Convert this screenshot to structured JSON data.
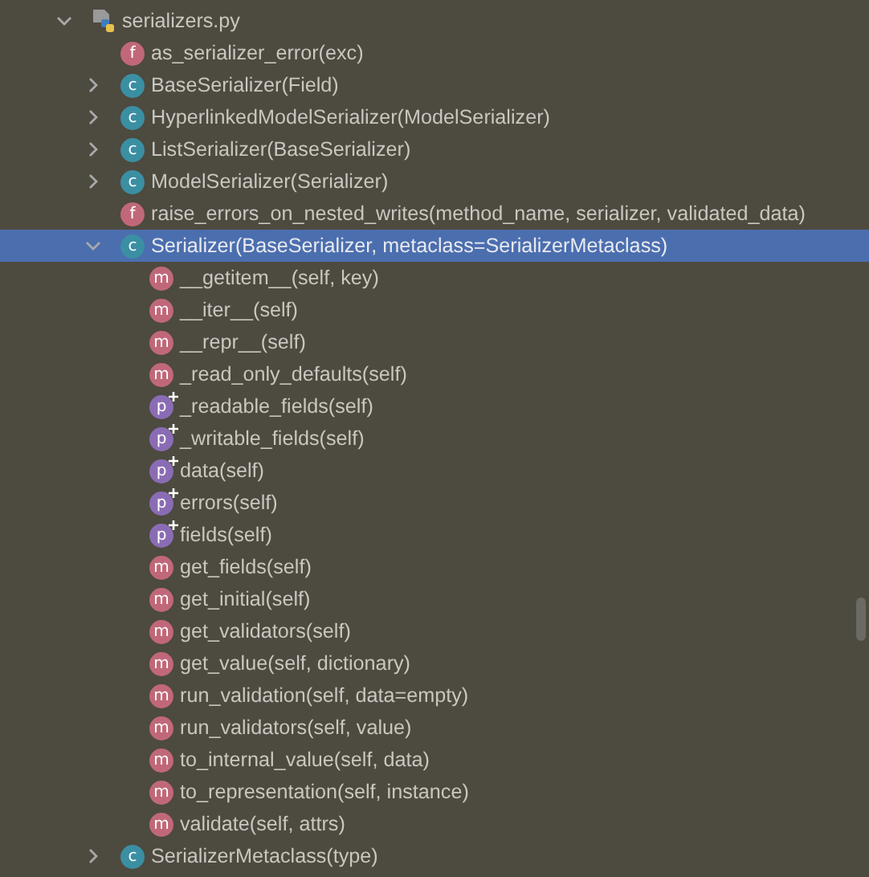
{
  "tree": [
    {
      "label": "serializers.py",
      "kind": "file",
      "expanded": true,
      "selected": false,
      "children": [
        {
          "label": "as_serializer_error(exc)",
          "kind": "function",
          "badge": "f",
          "selected": false
        },
        {
          "label": "BaseSerializer(Field)",
          "kind": "class",
          "badge": "c",
          "expanded": false,
          "selected": false
        },
        {
          "label": "HyperlinkedModelSerializer(ModelSerializer)",
          "kind": "class",
          "badge": "c",
          "expanded": false,
          "selected": false
        },
        {
          "label": "ListSerializer(BaseSerializer)",
          "kind": "class",
          "badge": "c",
          "expanded": false,
          "selected": false
        },
        {
          "label": "ModelSerializer(Serializer)",
          "kind": "class",
          "badge": "c",
          "expanded": false,
          "selected": false
        },
        {
          "label": "raise_errors_on_nested_writes(method_name, serializer, validated_data)",
          "kind": "function",
          "badge": "f",
          "selected": false
        },
        {
          "label": "Serializer(BaseSerializer, metaclass=SerializerMetaclass)",
          "kind": "class",
          "badge": "c",
          "expanded": true,
          "selected": true,
          "children": [
            {
              "label": "__getitem__(self, key)",
              "kind": "method",
              "badge": "m",
              "selected": false
            },
            {
              "label": "__iter__(self)",
              "kind": "method",
              "badge": "m",
              "selected": false
            },
            {
              "label": "__repr__(self)",
              "kind": "method",
              "badge": "m",
              "selected": false
            },
            {
              "label": "_read_only_defaults(self)",
              "kind": "method",
              "badge": "m",
              "selected": false
            },
            {
              "label": "_readable_fields(self)",
              "kind": "property",
              "badge": "p",
              "selected": false
            },
            {
              "label": "_writable_fields(self)",
              "kind": "property",
              "badge": "p",
              "selected": false
            },
            {
              "label": "data(self)",
              "kind": "property",
              "badge": "p",
              "selected": false
            },
            {
              "label": "errors(self)",
              "kind": "property",
              "badge": "p",
              "selected": false
            },
            {
              "label": "fields(self)",
              "kind": "property",
              "badge": "p",
              "selected": false
            },
            {
              "label": "get_fields(self)",
              "kind": "method",
              "badge": "m",
              "selected": false
            },
            {
              "label": "get_initial(self)",
              "kind": "method",
              "badge": "m",
              "selected": false
            },
            {
              "label": "get_validators(self)",
              "kind": "method",
              "badge": "m",
              "selected": false
            },
            {
              "label": "get_value(self, dictionary)",
              "kind": "method",
              "badge": "m",
              "selected": false
            },
            {
              "label": "run_validation(self, data=empty)",
              "kind": "method",
              "badge": "m",
              "selected": false
            },
            {
              "label": "run_validators(self, value)",
              "kind": "method",
              "badge": "m",
              "selected": false
            },
            {
              "label": "to_internal_value(self, data)",
              "kind": "method",
              "badge": "m",
              "selected": false
            },
            {
              "label": "to_representation(self, instance)",
              "kind": "method",
              "badge": "m",
              "selected": false
            },
            {
              "label": "validate(self, attrs)",
              "kind": "method",
              "badge": "m",
              "selected": false
            }
          ]
        },
        {
          "label": "SerializerMetaclass(type)",
          "kind": "class",
          "badge": "c",
          "expanded": false,
          "selected": false
        }
      ]
    }
  ]
}
